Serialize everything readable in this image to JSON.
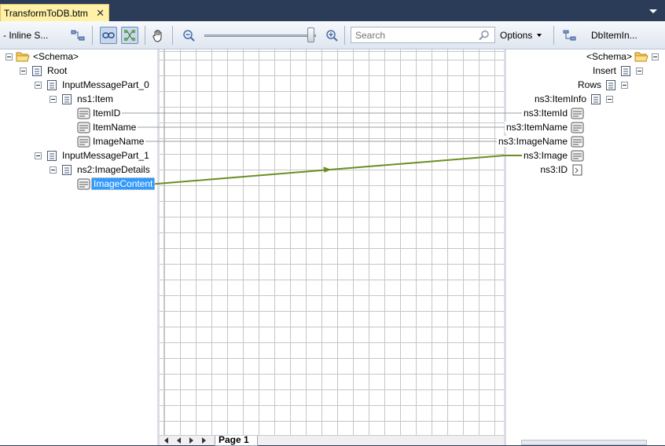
{
  "tab": {
    "title": "TransformToDB.btm",
    "close_glyph": "✕"
  },
  "toolbar": {
    "toolbox_label": "- Inline S...",
    "search_placeholder": "Search",
    "options_label": "Options",
    "dbitem_label": "DbItemIn...",
    "zoom_level": 1.0
  },
  "source_tree": {
    "schema": "<Schema>",
    "root": "Root",
    "part0": "InputMessagePart_0",
    "item": "ns1:Item",
    "item_id": "ItemID",
    "item_name": "ItemName",
    "image_name": "ImageName",
    "part1": "InputMessagePart_1",
    "image_details": "ns2:ImageDetails",
    "image_content": "ImageContent"
  },
  "dest_tree": {
    "schema": "<Schema>",
    "insert": "Insert",
    "rows": "Rows",
    "item_info": "ns3:ItemInfo",
    "item_id": "ns3:ItemId",
    "item_name": "ns3:ItemName",
    "image_name": "ns3:ImageName",
    "image": "ns3:Image",
    "id": "ns3:ID"
  },
  "links": {
    "color": "#6b8e23"
  },
  "pages": {
    "page1": "Page 1"
  }
}
